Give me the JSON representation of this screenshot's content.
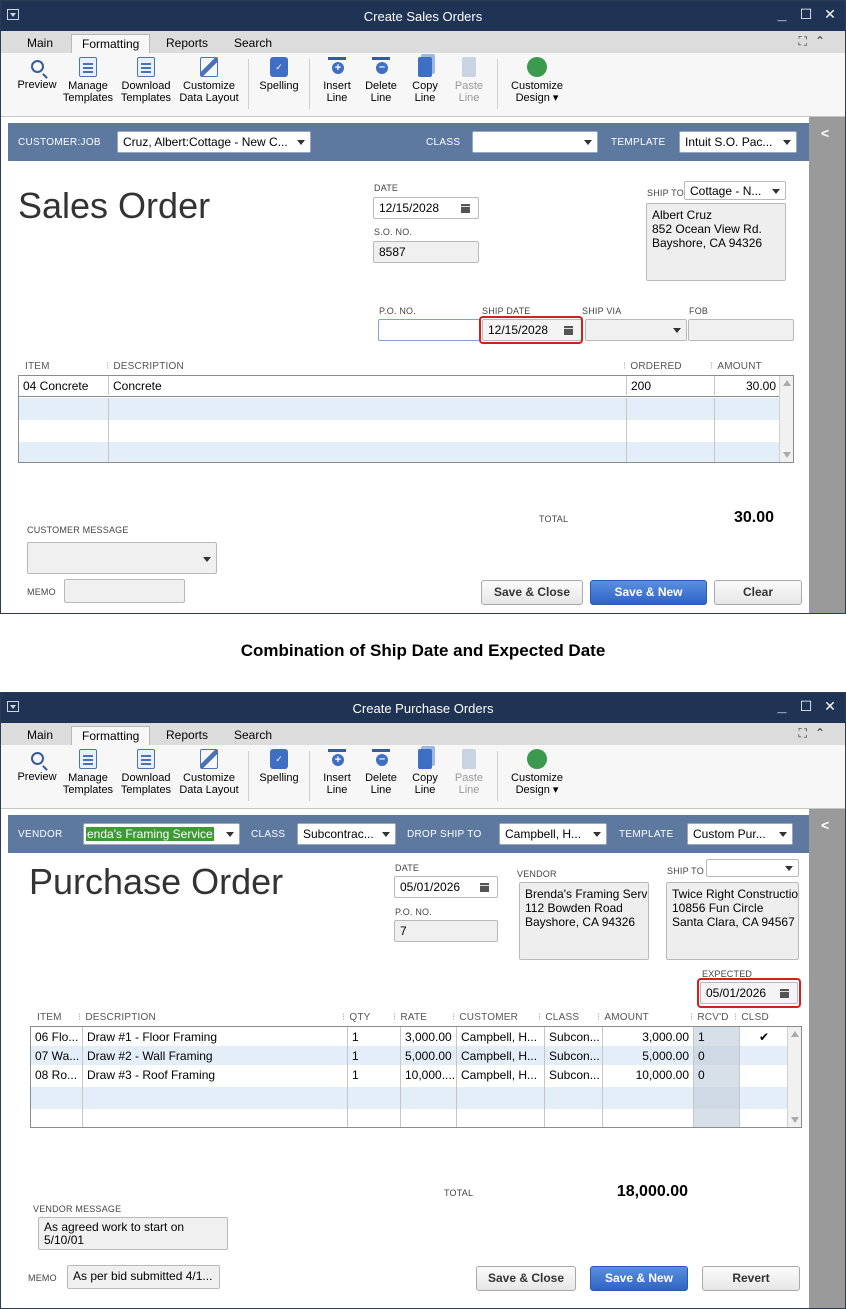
{
  "caption": "Combination of Ship Date and Expected Date",
  "sales_order": {
    "window_title": "Create Sales Orders",
    "tabs": [
      "Main",
      "Formatting",
      "Reports",
      "Search"
    ],
    "toolbar": [
      {
        "icon": "preview-icon",
        "line1": "Preview",
        "line2": ""
      },
      {
        "icon": "manage-templates-icon",
        "line1": "Manage",
        "line2": "Templates"
      },
      {
        "icon": "download-templates-icon",
        "line1": "Download",
        "line2": "Templates"
      },
      {
        "icon": "customize-data-layout-icon",
        "line1": "Customize",
        "line2": "Data Layout"
      },
      {
        "icon": "spelling-icon",
        "line1": "Spelling",
        "line2": ""
      },
      {
        "icon": "insert-line-icon",
        "line1": "Insert",
        "line2": "Line"
      },
      {
        "icon": "delete-line-icon",
        "line1": "Delete",
        "line2": "Line"
      },
      {
        "icon": "copy-line-icon",
        "line1": "Copy",
        "line2": "Line"
      },
      {
        "icon": "paste-line-icon",
        "line1": "Paste",
        "line2": "Line"
      },
      {
        "icon": "customize-design-icon",
        "line1": "Customize",
        "line2": "Design ▾"
      }
    ],
    "header": {
      "customer_job_label": "CUSTOMER:JOB",
      "customer_job_value": "Cruz, Albert:Cottage - New C...",
      "class_label": "CLASS",
      "class_value": "",
      "template_label": "TEMPLATE",
      "template_value": "Intuit S.O. Pac..."
    },
    "title": "Sales Order",
    "date_label": "DATE",
    "date_value": "12/15/2028",
    "so_no_label": "S.O. NO.",
    "so_no_value": "8587",
    "ship_to_label": "SHIP TO",
    "ship_to_value": "Cottage - N...",
    "ship_to_address": "Albert Cruz\n852 Ocean View Rd.\nBayshore, CA 94326",
    "po_no_label": "P.O. NO.",
    "po_no_value": "",
    "ship_date_label": "SHIP DATE",
    "ship_date_value": "12/15/2028",
    "ship_via_label": "SHIP VIA",
    "ship_via_value": "",
    "fob_label": "FOB",
    "fob_value": "",
    "columns": [
      "ITEM",
      "DESCRIPTION",
      "ORDERED",
      "AMOUNT"
    ],
    "rows": [
      {
        "item": "04 Concrete",
        "description": "Concrete",
        "ordered": "200",
        "amount": "30.00"
      }
    ],
    "total_label": "TOTAL",
    "total_value": "30.00",
    "customer_message_label": "CUSTOMER MESSAGE",
    "customer_message_value": "",
    "memo_label": "MEMO",
    "memo_value": "",
    "buttons": {
      "save_close": "Save & Close",
      "save_new": "Save & New",
      "clear": "Clear"
    }
  },
  "purchase_order": {
    "window_title": "Create Purchase Orders",
    "tabs": [
      "Main",
      "Formatting",
      "Reports",
      "Search"
    ],
    "toolbar": [
      {
        "icon": "preview-icon",
        "line1": "Preview",
        "line2": ""
      },
      {
        "icon": "manage-templates-icon",
        "line1": "Manage",
        "line2": "Templates"
      },
      {
        "icon": "download-templates-icon",
        "line1": "Download",
        "line2": "Templates"
      },
      {
        "icon": "customize-data-layout-icon",
        "line1": "Customize",
        "line2": "Data Layout"
      },
      {
        "icon": "spelling-icon",
        "line1": "Spelling",
        "line2": ""
      },
      {
        "icon": "insert-line-icon",
        "line1": "Insert",
        "line2": "Line"
      },
      {
        "icon": "delete-line-icon",
        "line1": "Delete",
        "line2": "Line"
      },
      {
        "icon": "copy-line-icon",
        "line1": "Copy",
        "line2": "Line"
      },
      {
        "icon": "paste-line-icon",
        "line1": "Paste",
        "line2": "Line"
      },
      {
        "icon": "customize-design-icon",
        "line1": "Customize",
        "line2": "Design ▾"
      }
    ],
    "header": {
      "vendor_label": "VENDOR",
      "vendor_value": "enda's Framing Service",
      "class_label": "CLASS",
      "class_value": "Subcontrac...",
      "drop_ship_label": "DROP SHIP TO",
      "drop_ship_value": "Campbell, H...",
      "template_label": "TEMPLATE",
      "template_value": "Custom Pur..."
    },
    "title": "Purchase Order",
    "date_label": "DATE",
    "date_value": "05/01/2026",
    "po_no_label": "P.O. NO.",
    "po_no_value": "7",
    "vendor_box_label": "VENDOR",
    "vendor_address": "Brenda's Framing Serv\n112 Bowden Road\nBayshore, CA 94326",
    "ship_to_label": "SHIP TO",
    "ship_to_value": "",
    "ship_to_address": "Twice Right Constructio\n10856 Fun Circle\nSanta Clara, CA 94567",
    "expected_label": "EXPECTED",
    "expected_value": "05/01/2026",
    "columns": [
      "ITEM",
      "DESCRIPTION",
      "QTY",
      "RATE",
      "CUSTOMER",
      "CLASS",
      "AMOUNT",
      "RCV'D",
      "CLSD"
    ],
    "rows": [
      {
        "item": "06 Flo...",
        "description": "Draw #1 - Floor Framing",
        "qty": "1",
        "rate": "3,000.00",
        "customer": "Campbell, H...",
        "class": "Subcon...",
        "amount": "3,000.00",
        "rcvd": "1",
        "clsd": "✔"
      },
      {
        "item": "07 Wa...",
        "description": "Draw #2 - Wall Framing",
        "qty": "1",
        "rate": "5,000.00",
        "customer": "Campbell, H...",
        "class": "Subcon...",
        "amount": "5,000.00",
        "rcvd": "0",
        "clsd": ""
      },
      {
        "item": "08 Ro...",
        "description": "Draw #3 - Roof Framing",
        "qty": "1",
        "rate": "10,000....",
        "customer": "Campbell, H...",
        "class": "Subcon...",
        "amount": "10,000.00",
        "rcvd": "0",
        "clsd": ""
      }
    ],
    "total_label": "TOTAL",
    "total_value": "18,000.00",
    "vendor_message_label": "VENDOR MESSAGE",
    "vendor_message_value": "As agreed work to start on\n5/10/01",
    "memo_label": "MEMO",
    "memo_value": "As per bid submitted 4/1...",
    "buttons": {
      "save_close": "Save & Close",
      "save_new": "Save & New",
      "revert": "Revert"
    }
  },
  "colors": {
    "title_bar": "#1f3354",
    "header_bar": "#5e79a0",
    "highlight": "#d0201f",
    "primary_button": "#2f64c4",
    "vendor_selection": "#3d9b33"
  }
}
